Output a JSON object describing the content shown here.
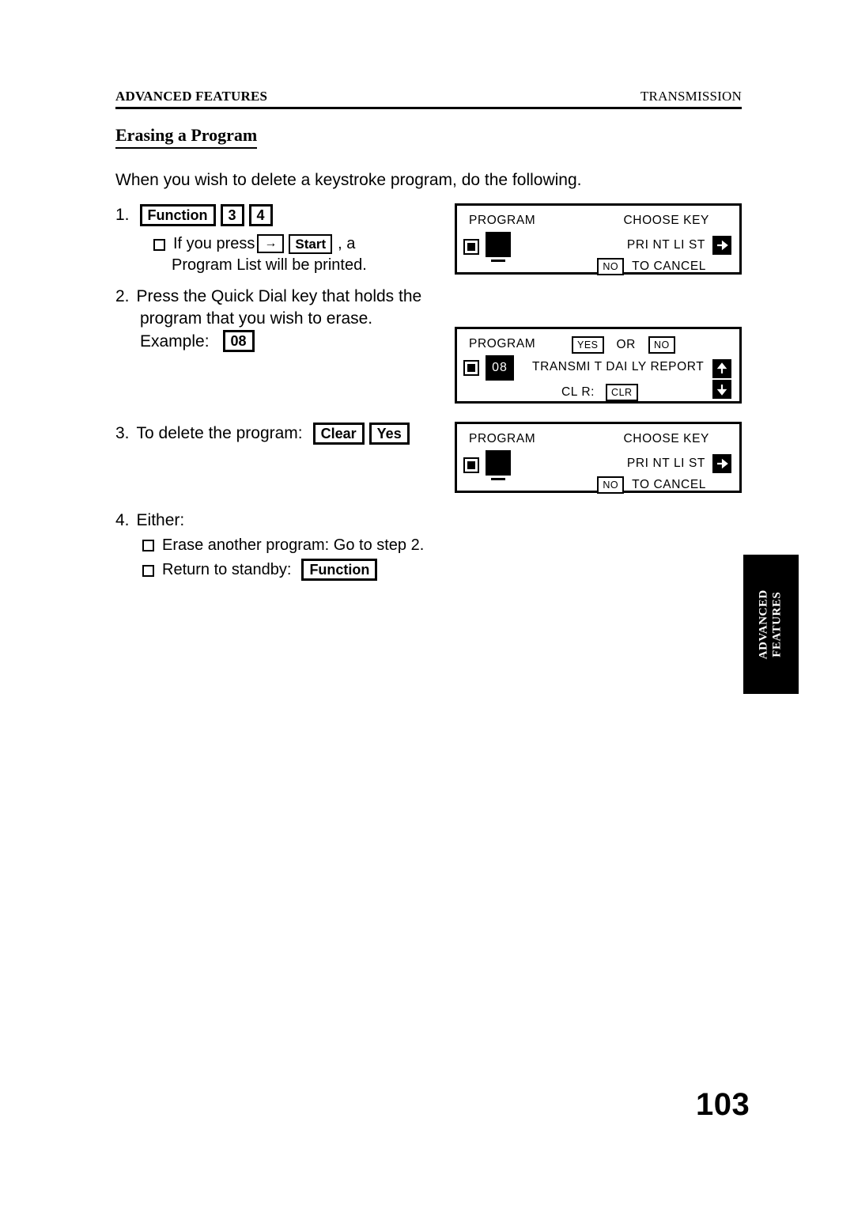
{
  "header": {
    "left": "ADVANCED FEATURES",
    "right": "TRANSMISSION"
  },
  "section": {
    "heading": "Erasing a Program",
    "intro": "When you wish to delete a keystroke program, do the following."
  },
  "steps": [
    {
      "number": "1.",
      "keys": [
        "Function",
        "3",
        "4"
      ],
      "note_bullet_pre": "If you press",
      "note_key_arrow": "→",
      "note_key_start": "Start",
      "note_bullet_post": ", a",
      "note_line2": "Program List will be printed."
    },
    {
      "number": "2.",
      "line1": "Press the Quick Dial key that holds the",
      "line2": "program that you wish to erase.",
      "example_label": "Example:",
      "example_key": "08"
    },
    {
      "number": "3.",
      "label": "To delete the program:",
      "keys": [
        "Clear",
        "Yes"
      ]
    },
    {
      "number": "4.",
      "label": "Either:",
      "bullets": [
        {
          "text": "Erase another program: Go to step 2.",
          "key": ""
        },
        {
          "text": "Return to standby:",
          "key": "Function"
        }
      ]
    }
  ],
  "displays": [
    {
      "title": "PROGRAM",
      "top_right": "CHOOSE KEY",
      "entry_value": "",
      "entry_style": "blank-block",
      "mid_right": "PRI NT LI ST",
      "mid_right_icon": "arrow-right-icon",
      "bottom_softkey": "NO",
      "bottom_text": "TO CANCEL"
    },
    {
      "title": "PROGRAM",
      "top_softkey_yes": "YES",
      "top_or": "OR",
      "top_softkey_no": "NO",
      "entry_value": "08",
      "entry_style": "inverse",
      "mid_text": "TRANSMI T DAI LY REPORT",
      "mid_icon": "arrow-up-icon",
      "bottom_label": "CL R:",
      "bottom_softkey": "CLR",
      "bottom_icon": "arrow-down-icon"
    },
    {
      "title": "PROGRAM",
      "top_right": "CHOOSE KEY",
      "entry_value": "",
      "entry_style": "blank-block",
      "mid_right": "PRI NT LI ST",
      "mid_right_icon": "arrow-right-icon",
      "bottom_softkey": "NO",
      "bottom_text": "TO CANCEL"
    }
  ],
  "side_tab": {
    "line1": "ADVANCED",
    "line2": "FEATURES"
  },
  "page_number": "103"
}
